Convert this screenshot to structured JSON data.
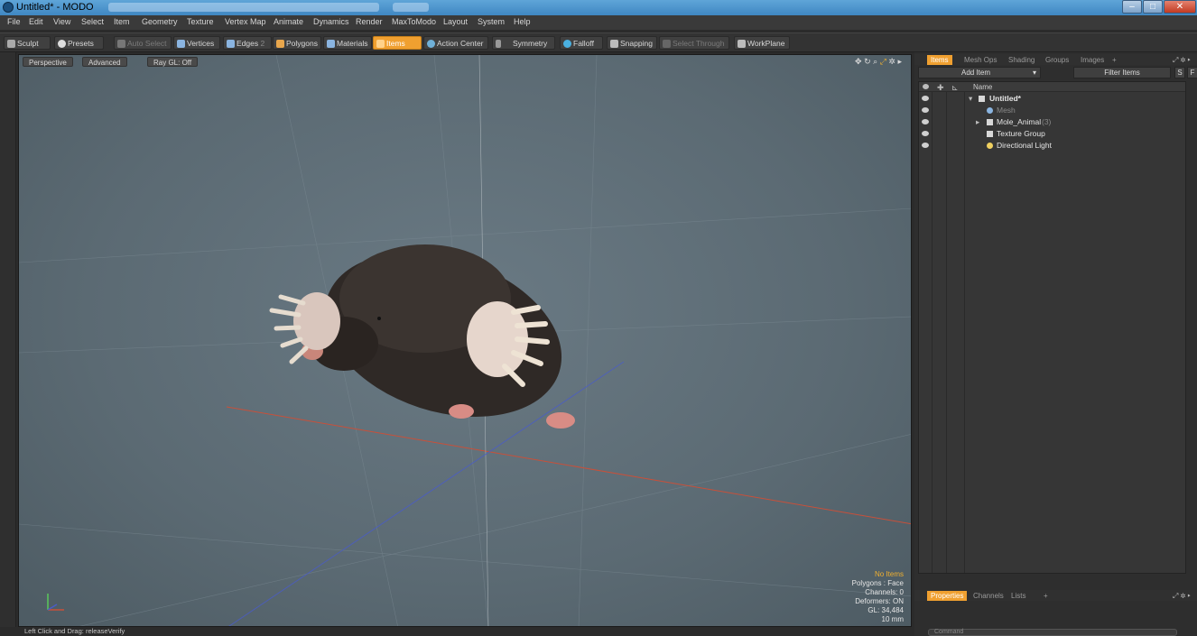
{
  "window": {
    "title": "Untitled* - MODO"
  },
  "menu": [
    "File",
    "Edit",
    "View",
    "Select",
    "Item",
    "Geometry",
    "Texture",
    "Vertex Map",
    "Animate",
    "Dynamics",
    "Render",
    "MaxToModo",
    "Layout",
    "System",
    "Help"
  ],
  "toolbar": {
    "sculpt": "Sculpt",
    "presets": "Presets",
    "auto_select": "Auto Select",
    "vertices": "Vertices",
    "edges": "Edges",
    "edges_count": "2",
    "polygons": "Polygons",
    "materials": "Materials",
    "items": "Items",
    "action_center": "Action Center",
    "symmetry": "Symmetry",
    "falloff": "Falloff",
    "snapping": "Snapping",
    "select_through": "Select Through",
    "workplane": "WorkPlane"
  },
  "viewport": {
    "tabs": [
      "Perspective",
      "Advanced",
      "Ray GL: Off"
    ],
    "info": {
      "selection": "No Items",
      "polygons": "Polygons : Face",
      "channels": "Channels: 0",
      "deformers": "Deformers: ON",
      "gl": "GL: 34,484",
      "scale": "10 mm"
    }
  },
  "panel_tabs": [
    "Items",
    "Mesh Ops",
    "Shading",
    "Groups",
    "Images",
    "+"
  ],
  "items_panel": {
    "add_item": "Add Item",
    "filter_items": "Filter Items",
    "s_btn": "S",
    "f_btn": "F",
    "column_name": "Name",
    "tree": [
      {
        "label": "Untitled*",
        "count": ""
      },
      {
        "label": "Mesh",
        "count": ""
      },
      {
        "label": "Mole_Animal",
        "count": "(3)"
      },
      {
        "label": "Texture Group",
        "count": ""
      },
      {
        "label": "Directional Light",
        "count": ""
      }
    ]
  },
  "properties_tabs": [
    "Properties",
    "Channels",
    "Lists",
    "+"
  ],
  "status": {
    "text": "Left Click and Drag:  releaseVerify"
  },
  "command": {
    "placeholder": "Command"
  },
  "colors": {
    "accent": "#f0a030",
    "viewport_bg": "#5e6d76"
  }
}
